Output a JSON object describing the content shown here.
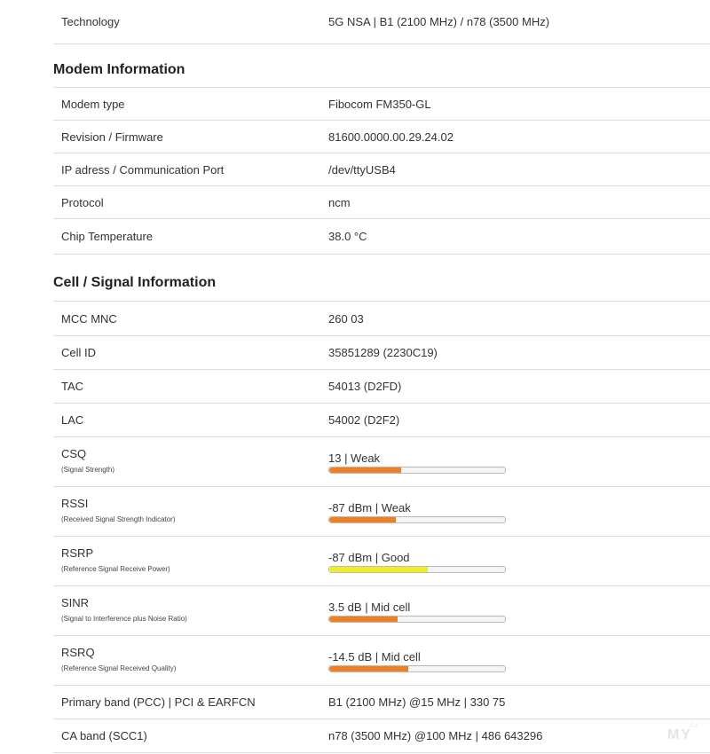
{
  "top_rows": [
    {
      "label": "Technology",
      "value": "5G NSA | B1 (2100 MHz) / n78 (3500 MHz)"
    }
  ],
  "modem": {
    "title": "Modem Information",
    "rows": [
      {
        "label": "Modem type",
        "value": "Fibocom FM350-GL"
      },
      {
        "label": "Revision / Firmware",
        "value": "81600.0000.00.29.24.02"
      },
      {
        "label": "IP adress / Communication Port",
        "value": "/dev/ttyUSB4"
      },
      {
        "label": "Protocol",
        "value": "ncm"
      },
      {
        "label": "Chip Temperature",
        "value": "38.0 °C"
      }
    ]
  },
  "cell": {
    "title": "Cell / Signal Information",
    "rows": [
      {
        "label": "MCC MNC",
        "value": "260 03"
      },
      {
        "label": "Cell ID",
        "value": "35851289 (2230C19)"
      },
      {
        "label": "TAC",
        "value": "54013 (D2FD)"
      },
      {
        "label": "LAC",
        "value": "54002 (D2F2)"
      }
    ],
    "signal_rows": [
      {
        "label": "CSQ",
        "sublabel": "(Signal Strength)",
        "value": "13 | Weak",
        "level": 0.41,
        "color": "#f07f22"
      },
      {
        "label": "RSSI",
        "sublabel": "(Received Signal Strength Indicator)",
        "value": "-87 dBm | Weak",
        "level": 0.38,
        "color": "#f07f22"
      },
      {
        "label": "RSRP",
        "sublabel": "(Reference Signal Receive Power)",
        "value": "-87 dBm | Good",
        "level": 0.56,
        "color": "#eeee22"
      },
      {
        "label": "SINR",
        "sublabel": "(Signal to Interference plus Noise Ratio)",
        "value": "3.5 dB | Mid cell",
        "level": 0.39,
        "color": "#f07f22"
      },
      {
        "label": "RSRQ",
        "sublabel": "(Reference Signal Received Quality)",
        "value": "-14.5 dB | Mid cell",
        "level": 0.45,
        "color": "#f07f22"
      }
    ],
    "band_rows": [
      {
        "label": "Primary band (PCC) | PCI & EARFCN",
        "value": "B1 (2100 MHz) @15 MHz | 330 75"
      },
      {
        "label": "CA band (SCC1)",
        "value": "n78 (3500 MHz) @100 MHz | 486 643296"
      }
    ]
  },
  "watermark": {
    "main": "MY",
    "small": ".ru"
  }
}
